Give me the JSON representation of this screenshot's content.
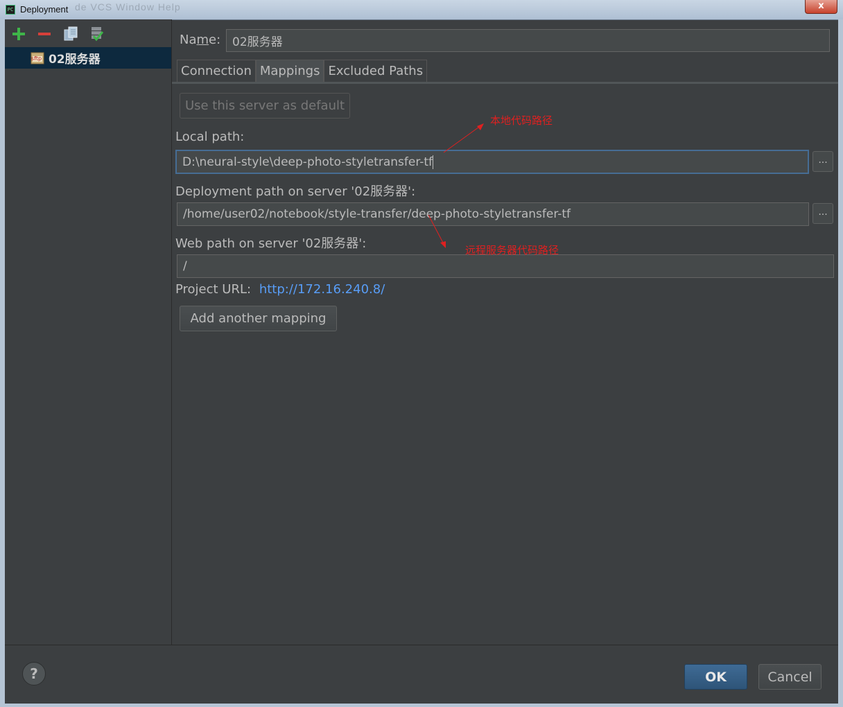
{
  "window": {
    "title": "Deployment",
    "ghost_title": "de  VCS  Window  Help",
    "close_label": "x"
  },
  "toolbar": {
    "icons": [
      "add-icon",
      "remove-icon",
      "copy-icon",
      "set-default-icon"
    ]
  },
  "sidebar": {
    "items": [
      {
        "label": "02服务器",
        "icon": "sftp-icon",
        "icon_text": "sftp",
        "selected": true
      }
    ]
  },
  "form": {
    "name_label_pre": "Na",
    "name_label_mnemonic": "m",
    "name_label_post": "e:",
    "name_value": "02服务器"
  },
  "tabs": [
    {
      "label": "Connection",
      "active": false
    },
    {
      "label": "Mappings",
      "active": true
    },
    {
      "label": "Excluded Paths",
      "active": false
    }
  ],
  "mappings": {
    "default_button": "Use this server as default",
    "local_path_label": "Local path:",
    "local_path_value": "D:\\neural-style\\deep-photo-styletransfer-tf",
    "deployment_path_label": "Deployment path on server '02服务器':",
    "deployment_path_value": "/home/user02/notebook/style-transfer/deep-photo-styletransfer-tf",
    "web_path_label": "Web path on server '02服务器':",
    "web_path_value": "/",
    "project_url_label": "Project URL:",
    "project_url_value": "http://172.16.240.8/",
    "add_mapping_button": "Add another mapping",
    "browse_label": "..."
  },
  "annotations": {
    "local": "本地代码路径",
    "remote": "远程服务器代码路径",
    "color": "#e02020"
  },
  "footer": {
    "help_label": "?",
    "ok_label": "OK",
    "cancel_label": "Cancel"
  },
  "colors": {
    "background": "#3c3f41",
    "selection": "#0d293e",
    "link": "#589df6",
    "ok_button": "#365e86"
  }
}
